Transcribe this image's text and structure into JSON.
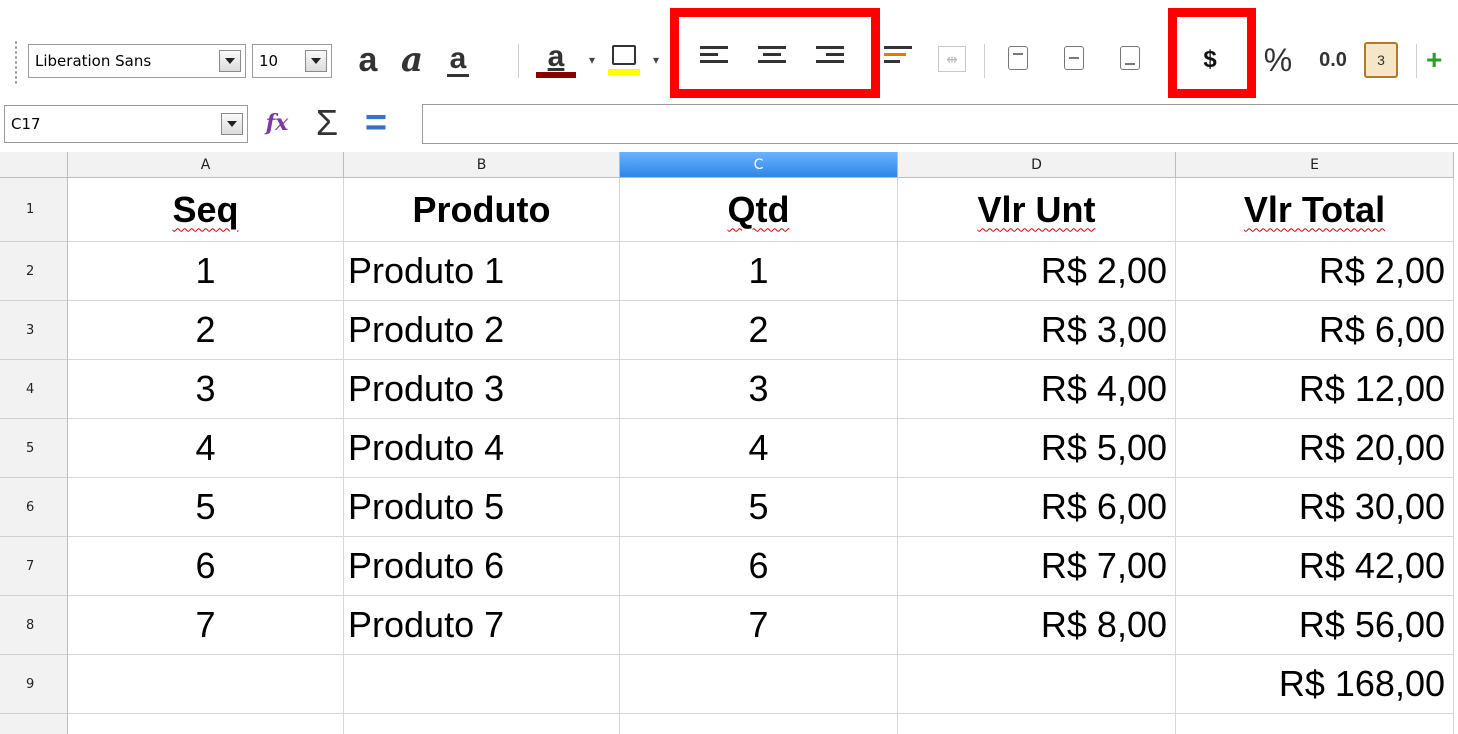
{
  "toolbar": {
    "font_name": "Liberation Sans",
    "font_size": "10",
    "bold_icon": "a",
    "italic_icon": "a",
    "underline_icon": "a",
    "font_color_icon": "a",
    "currency_label": "$",
    "percent_label": "%",
    "number_format_label": "0.0",
    "colors": {
      "highlight_frame": "#ff0000",
      "font_color": "#8b0000",
      "highlight": "#ffff00"
    }
  },
  "formula_bar": {
    "name_box": "C17",
    "sum_icon": "Σ",
    "equals_icon": "=",
    "formula_value": ""
  },
  "grid": {
    "columns": [
      "A",
      "B",
      "C",
      "D",
      "E"
    ],
    "active_column": "C",
    "row_numbers": [
      "1",
      "2",
      "3",
      "4",
      "5",
      "6",
      "7",
      "8",
      "9"
    ],
    "header": [
      "Seq",
      "Produto",
      "Qtd",
      "Vlr Unt",
      "Vlr Total"
    ],
    "rows": [
      [
        "1",
        "Produto 1",
        "1",
        "R$ 2,00",
        "R$ 2,00"
      ],
      [
        "2",
        "Produto 2",
        "2",
        "R$ 3,00",
        "R$ 6,00"
      ],
      [
        "3",
        "Produto 3",
        "3",
        "R$ 4,00",
        "R$ 12,00"
      ],
      [
        "4",
        "Produto 4",
        "4",
        "R$ 5,00",
        "R$ 20,00"
      ],
      [
        "5",
        "Produto 5",
        "5",
        "R$ 6,00",
        "R$ 30,00"
      ],
      [
        "6",
        "Produto 6",
        "6",
        "R$ 7,00",
        "R$ 42,00"
      ],
      [
        "7",
        "Produto 7",
        "7",
        "R$ 8,00",
        "R$ 56,00"
      ]
    ],
    "total_row": [
      "",
      "",
      "",
      "",
      "R$ 168,00"
    ]
  }
}
